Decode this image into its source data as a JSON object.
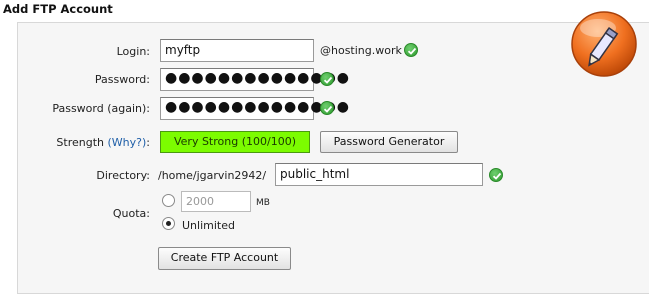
{
  "heading": "Add FTP Account",
  "login": {
    "label": "Login:",
    "value": "myftp",
    "suffix": "@hosting.work"
  },
  "password": {
    "label": "Password:",
    "value": "●●●●●●●●●●●●●●"
  },
  "password_again": {
    "label": "Password (again):",
    "value": "●●●●●●●●●●●●●●"
  },
  "strength": {
    "label": "Strength",
    "why_link": "(Why?)",
    "colon": ":",
    "value": "Very Strong (100/100)"
  },
  "generator_button": "Password Generator",
  "directory": {
    "label": "Directory:",
    "prefix": "/home/jgarvin2942/",
    "value": "public_html"
  },
  "quota": {
    "label": "Quota:",
    "value": "2000",
    "unit": "MB",
    "unlimited_label": "Unlimited",
    "selected": "Unlimited"
  },
  "submit_button": "Create FTP Account",
  "colors": {
    "strength_bg": "#7cfc00",
    "check_green": "#2e9a2e",
    "icon_orange": "#f07020"
  },
  "icons": [
    "check-icon",
    "pencil-icon",
    "radio-icon"
  ]
}
